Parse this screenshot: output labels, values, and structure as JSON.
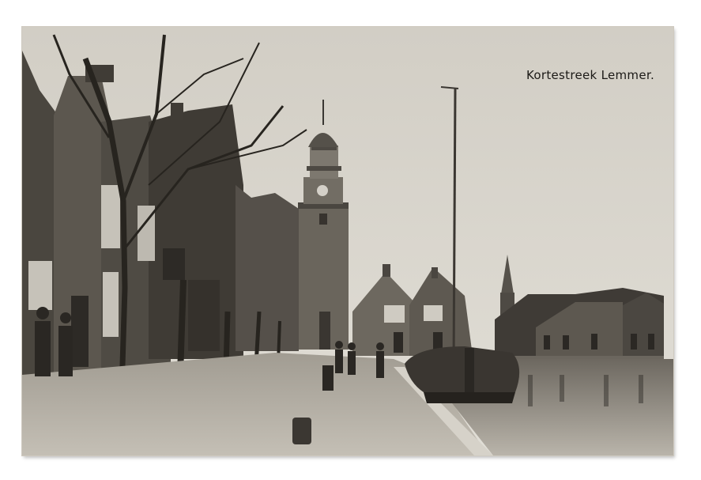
{
  "postcard": {
    "caption": "Kortestreek  Lemmer."
  }
}
